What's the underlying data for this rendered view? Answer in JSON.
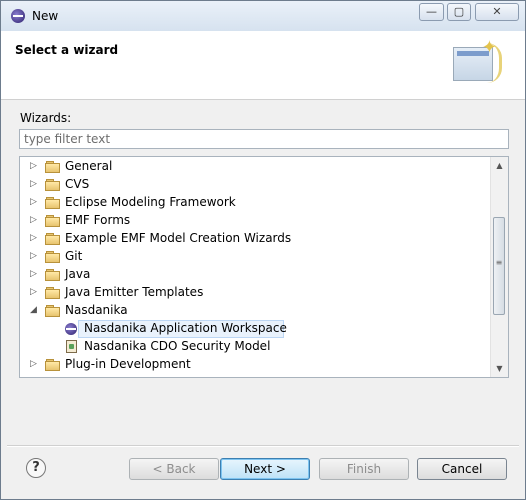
{
  "window": {
    "title": "New"
  },
  "banner": {
    "heading": "Select a wizard"
  },
  "wizards_label": "Wizards:",
  "filter": {
    "placeholder": "type filter text",
    "value": ""
  },
  "tree_items": [
    {
      "label": "General",
      "icon": "folder-icon",
      "expanded": false
    },
    {
      "label": "CVS",
      "icon": "folder-icon",
      "expanded": false
    },
    {
      "label": "Eclipse Modeling Framework",
      "icon": "folder-icon",
      "expanded": false
    },
    {
      "label": "EMF Forms",
      "icon": "folder-icon",
      "expanded": false
    },
    {
      "label": "Example EMF Model Creation Wizards",
      "icon": "folder-icon",
      "expanded": false
    },
    {
      "label": "Git",
      "icon": "folder-icon",
      "expanded": false
    },
    {
      "label": "Java",
      "icon": "folder-icon",
      "expanded": false
    },
    {
      "label": "Java Emitter Templates",
      "icon": "folder-icon",
      "expanded": false
    },
    {
      "label": "Nasdanika",
      "icon": "folder-icon",
      "expanded": true
    },
    {
      "label": "Nasdanika Application Workspace",
      "icon": "eclipse-icon",
      "child": true,
      "selected": true
    },
    {
      "label": "Nasdanika CDO Security Model",
      "icon": "security-model-icon",
      "child": true
    },
    {
      "label": "Plug-in Development",
      "icon": "folder-icon",
      "expanded": false
    }
  ],
  "buttons": {
    "help": "?",
    "back": "< Back",
    "next": "Next >",
    "finish": "Finish",
    "cancel": "Cancel"
  },
  "colors": {
    "selection_bg": "#e9f2fc",
    "selection_border": "#bcd6f4",
    "default_button_border": "#3c7fb1"
  }
}
